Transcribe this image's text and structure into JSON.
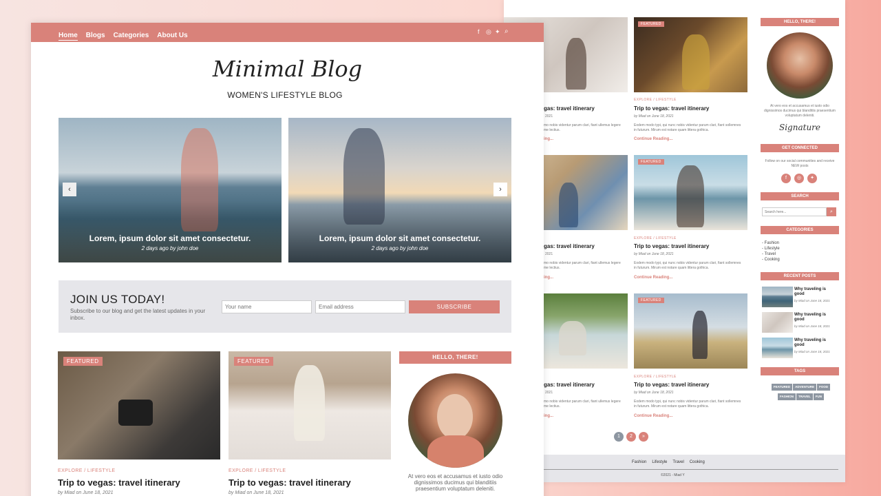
{
  "left": {
    "nav": {
      "home": "Home",
      "blogs": "Blogs",
      "categories": "Categories",
      "about": "About Us"
    },
    "brand": {
      "logo": "Minimal Blog",
      "tagline": "WOMEN'S LIFESTYLE BLOG"
    },
    "slider": [
      {
        "caption": "Lorem, ipsum dolor sit amet consectetur.",
        "meta": "2 days ago by john doe"
      },
      {
        "caption": "Lorem, ipsum dolor sit amet consectetur.",
        "meta": "2 days ago by john doe"
      }
    ],
    "join": {
      "title": "JOIN US TODAY!",
      "text": "Subscribe to our blog and get the latest updates in your inbox.",
      "name_placeholder": "Your name",
      "email_placeholder": "Email address",
      "button": "SUBSCRIBE"
    },
    "posts": [
      {
        "badge": "FEATURED",
        "category": "EXPLORE / LIFESTYLE",
        "title": "Trip to vegas: travel itinerary",
        "meta": "by Miad on June 18, 2021"
      },
      {
        "badge": "FEATURED",
        "category": "EXPLORE / LIFESTYLE",
        "title": "Trip to vegas: travel itinerary",
        "meta": "by Miad on June 18, 2021"
      }
    ],
    "sidebar": {
      "hello": "HELLO, THERE!",
      "about_text": "At vero eos et accusamus et iusto odio dignissimos ducimus qui blanditiis praesentium voluptatum deleniti."
    }
  },
  "right": {
    "posts": [
      {
        "badge": "",
        "category": "",
        "title": "gas: travel itinerary",
        "meta": "2021",
        "excerpt": "mo nobis videntur parum clari, fiant ullemus legere me lectius.",
        "readmore": "ing..."
      },
      {
        "badge": "FEATURED",
        "category": "EXPLORE / LIFESTYLE",
        "title": "Trip to vegas: travel itinerary",
        "meta": "by Miad on June 18, 2021",
        "excerpt": "Eodem modo typi, qui nunc nobis videntur parum clari, fiant sollemnes in futurum. Mirum est notare quam littera gothica.",
        "readmore": "Continue Reading..."
      },
      {
        "badge": "",
        "category": "",
        "title": "gas: travel itinerary",
        "meta": "2021",
        "excerpt": "mo nobis videntur parum clari, fiant ullemus legere me lectius.",
        "readmore": "ing..."
      },
      {
        "badge": "FEATURED",
        "category": "EXPLORE / LIFESTYLE",
        "title": "Trip to vegas: travel itinerary",
        "meta": "by Miad on June 18, 2021",
        "excerpt": "Eodem modo typi, qui nunc nobis videntur parum clari, fiant sollemnes in futurum. Mirum est notare quam littera gothica.",
        "readmore": "Continue Reading..."
      },
      {
        "badge": "",
        "category": "",
        "title": "gas: travel itinerary",
        "meta": "2021",
        "excerpt": "mo nobis videntur parum clari, fiant ullemus legere me lectius.",
        "readmore": "ing..."
      },
      {
        "badge": "FEATURED",
        "category": "EXPLORE / LIFESTYLE",
        "title": "Trip to vegas: travel itinerary",
        "meta": "by Miad on June 18, 2021",
        "excerpt": "Eodem modo typi, qui nunc nobis videntur parum clari, fiant sollemnes in futurum. Mirum est notare quam littera gothica.",
        "readmore": "Continue Reading..."
      }
    ],
    "pagination": [
      "1",
      "2",
      "»"
    ],
    "footer": {
      "links": [
        "Fashion",
        "Lifestyle",
        "Travel",
        "Cooking"
      ],
      "copyright": "©2021 - Miad Y"
    },
    "sidebar": {
      "hello": "HELLO, THERE!",
      "about_text": "At vero eos et accusamus et iusto odio dignissimos ducimus qui blanditiis praesentium voluptatum deleniti.",
      "signature": "Signature",
      "connected_title": "GET CONNECTED",
      "connected_text": "Follow on our social communities and receive NEW posts",
      "search_title": "SEARCH",
      "search_placeholder": "Search here...",
      "categories_title": "CATEGORIES",
      "categories": [
        "Fashion",
        "Lifestyle",
        "Travel",
        "Cooking"
      ],
      "recent_title": "RECENT POSTS",
      "recent": [
        {
          "title": "Why traveling is good",
          "meta": "by Miad on June 18, 2021"
        },
        {
          "title": "Why traveling is good",
          "meta": "by Miad on June 18, 2021"
        },
        {
          "title": "Why traveling is good",
          "meta": "by Miad on June 18, 2021"
        }
      ],
      "tags_title": "TAGS",
      "tags": [
        "FEATURED",
        "ADVENTURE",
        "FOOD",
        "FASHION",
        "TRAVEL",
        "FUN"
      ]
    }
  },
  "colors": {
    "accent": "#d9827a",
    "panel": "#e6e6ea",
    "tag": "#8d96a1"
  }
}
